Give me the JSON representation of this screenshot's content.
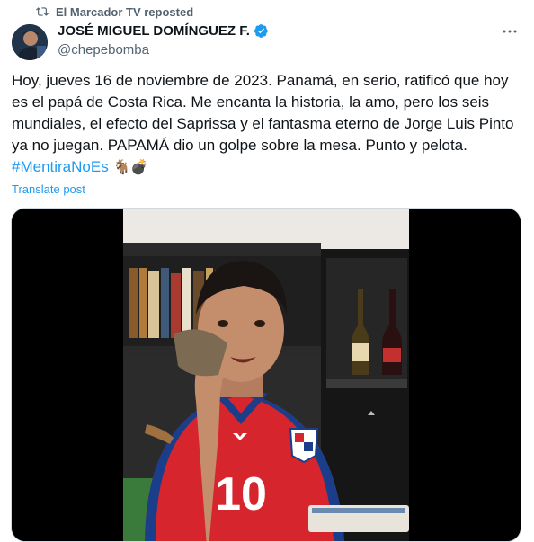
{
  "repost": {
    "text": "El Marcador TV reposted"
  },
  "author": {
    "name": "JOSÉ MIGUEL DOMÍNGUEZ F.",
    "handle": "@chepebomba",
    "verified": true
  },
  "post": {
    "text": "Hoy, jueves 16 de noviembre de 2023. Panamá, en serio, ratificó que hoy es el papá de Costa Rica. Me encanta la historia, la amo, pero los seis mundiales, el efecto del Saprissa y el fantasma eterno de Jorge Luis Pinto ya no juegan. PAPAMÁ dio un golpe sobre la mesa. Punto y pelota.",
    "hashtag": "#MentiraNoEs",
    "emojis": "🐐💣",
    "translate": "Translate post"
  },
  "media": {
    "jersey_number": "10"
  },
  "colors": {
    "accent": "#1d9bf0",
    "jersey": "#d6252d",
    "text_secondary": "#536471"
  },
  "icons": [
    "repost-icon",
    "verified-badge-icon",
    "more-options-icon"
  ]
}
